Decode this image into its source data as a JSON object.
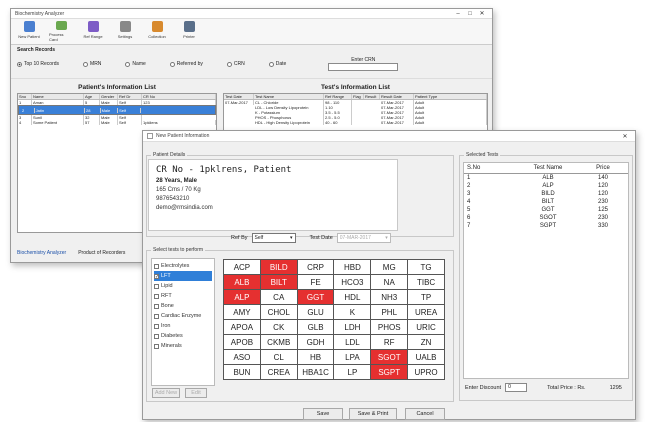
{
  "main_window": {
    "title": "Biochemistry Analyzer",
    "toolbar": [
      {
        "label": "New Patient",
        "icon": "new-patient-icon",
        "color": "#4a7fd0"
      },
      {
        "label": "Process Card",
        "icon": "process-card-icon",
        "color": "#6aa84f"
      },
      {
        "label": "Ref Range",
        "icon": "ref-range-icon",
        "color": "#7d5cc6"
      },
      {
        "label": "Settings",
        "icon": "settings-icon",
        "color": "#888888"
      },
      {
        "label": "Collection",
        "icon": "collection-icon",
        "color": "#d88a2e"
      },
      {
        "label": "Printer",
        "icon": "printer-icon",
        "color": "#5a6f8a"
      }
    ],
    "search": {
      "title": "Search Records",
      "options": [
        "Top 10 Records",
        "MRN",
        "Name",
        "Referred by",
        "CRN",
        "Date"
      ],
      "selected": 0,
      "enter_label": "Enter CRN"
    },
    "patient_list": {
      "title": "Patient's Information List",
      "columns": [
        "Sno",
        "Name",
        "Age",
        "Gender",
        "Ref Dr",
        "CR No"
      ],
      "rows": [
        [
          "1",
          "Aman",
          "5",
          "Male",
          "Self",
          "123"
        ],
        [
          "2",
          "Jatin",
          "28",
          "Male",
          "Self",
          ""
        ],
        [
          "3",
          "Sunil",
          "32",
          "Male",
          "Self",
          ""
        ],
        [
          "4",
          "Some Patient",
          "57",
          "Male",
          "Self",
          "1pkliens"
        ]
      ],
      "selected_row": 1
    },
    "test_list": {
      "title": "Test's Information List",
      "columns": [
        "Test Date",
        "Test Name",
        "Ref Range",
        "Flag",
        "Result",
        "Result Date",
        "Patient Type"
      ],
      "rows": [
        [
          "07-Mar-2017",
          "CL - Chloride",
          "98 - 110",
          "",
          "",
          "07-Mar-2017",
          "Adult"
        ],
        [
          "",
          "LDL - Low Density Lipoprotein",
          "1.10",
          "",
          "",
          "07-Mar-2017",
          "Adult"
        ],
        [
          "",
          "K - Potassium",
          "3.5 - 5.5",
          "",
          "",
          "07-Mar-2017",
          "Adult"
        ],
        [
          "",
          "PHOS - Phosphorus",
          "2.5 - 5.0",
          "",
          "",
          "07-Mar-2017",
          "Adult"
        ],
        [
          "",
          "HDL - High Density Lipoprotein",
          "40 - 60",
          "",
          "",
          "07-Mar-2017",
          "Adult"
        ]
      ]
    },
    "footer": [
      "Biochemistry Analyzer",
      "Product of Recorders"
    ]
  },
  "dialog": {
    "title": "New Patient Information",
    "patient_section": "Patient Details",
    "patient_name": "CR No - 1pklrens,  Patient",
    "age_gender": "28 Years, Male",
    "height_weight": "165 Cms / 70 Kg",
    "phone": "9876543210",
    "email": "demo@rmsindia.com",
    "ref_by_label": "Ref By",
    "ref_by_value": "Self",
    "test_date_label": "Test Date",
    "test_date_value": "07-MAR-2017",
    "select_section": "Select tests to perform",
    "categories": [
      {
        "name": "Electrolytes",
        "checked": false
      },
      {
        "name": "LFT",
        "checked": true
      },
      {
        "name": "Lipid",
        "checked": false
      },
      {
        "name": "RFT",
        "checked": false
      },
      {
        "name": "Bone",
        "checked": false
      },
      {
        "name": "Cardiac Enzyme",
        "checked": false
      },
      {
        "name": "Iron",
        "checked": false
      },
      {
        "name": "Diabetes",
        "checked": false
      },
      {
        "name": "Minerals",
        "checked": false
      }
    ],
    "selected_category": 1,
    "tests": [
      {
        "n": "ACP",
        "on": false
      },
      {
        "n": "BILD",
        "on": true
      },
      {
        "n": "CRP",
        "on": false
      },
      {
        "n": "HBD",
        "on": false
      },
      {
        "n": "MG",
        "on": false
      },
      {
        "n": "TG",
        "on": false
      },
      {
        "n": "ALB",
        "on": true
      },
      {
        "n": "BILT",
        "on": true
      },
      {
        "n": "FE",
        "on": false
      },
      {
        "n": "HCO3",
        "on": false
      },
      {
        "n": "NA",
        "on": false
      },
      {
        "n": "TIBC",
        "on": false
      },
      {
        "n": "ALP",
        "on": true
      },
      {
        "n": "CA",
        "on": false
      },
      {
        "n": "GGT",
        "on": true
      },
      {
        "n": "HDL",
        "on": false
      },
      {
        "n": "NH3",
        "on": false
      },
      {
        "n": "TP",
        "on": false
      },
      {
        "n": "AMY",
        "on": false
      },
      {
        "n": "CHOL",
        "on": false
      },
      {
        "n": "GLU",
        "on": false
      },
      {
        "n": "K",
        "on": false
      },
      {
        "n": "PHL",
        "on": false
      },
      {
        "n": "UREA",
        "on": false
      },
      {
        "n": "APOA",
        "on": false
      },
      {
        "n": "CK",
        "on": false
      },
      {
        "n": "GLB",
        "on": false
      },
      {
        "n": "LDH",
        "on": false
      },
      {
        "n": "PHOS",
        "on": false
      },
      {
        "n": "URIC",
        "on": false
      },
      {
        "n": "APOB",
        "on": false
      },
      {
        "n": "CKMB",
        "on": false
      },
      {
        "n": "GDH",
        "on": false
      },
      {
        "n": "LDL",
        "on": false
      },
      {
        "n": "RF",
        "on": false
      },
      {
        "n": "ZN",
        "on": false
      },
      {
        "n": "ASO",
        "on": false
      },
      {
        "n": "CL",
        "on": false
      },
      {
        "n": "HB",
        "on": false
      },
      {
        "n": "LPA",
        "on": false
      },
      {
        "n": "SGOT",
        "on": true
      },
      {
        "n": "UALB",
        "on": false
      },
      {
        "n": "BUN",
        "on": false
      },
      {
        "n": "CREA",
        "on": false
      },
      {
        "n": "HBA1C",
        "on": false
      },
      {
        "n": "LP",
        "on": false
      },
      {
        "n": "SGPT",
        "on": true
      },
      {
        "n": "UPRO",
        "on": false
      }
    ],
    "add_new": "Add New",
    "edit": "Edit",
    "selected_tests_section": "Selected Tests",
    "selected_columns": [
      "S.No",
      "Test Name",
      "Price"
    ],
    "selected_tests": [
      [
        "1",
        "ALB",
        "140"
      ],
      [
        "2",
        "ALP",
        "120"
      ],
      [
        "3",
        "BILD",
        "120"
      ],
      [
        "4",
        "BILT",
        "230"
      ],
      [
        "5",
        "GGT",
        "125"
      ],
      [
        "6",
        "SGOT",
        "230"
      ],
      [
        "7",
        "SGPT",
        "330"
      ]
    ],
    "discount_label": "Enter Discount",
    "discount_value": "0",
    "total_label": "Total Price : Rs.",
    "total_value": "1295",
    "save": "Save",
    "save_print": "Save & Print",
    "cancel": "Cancel"
  }
}
